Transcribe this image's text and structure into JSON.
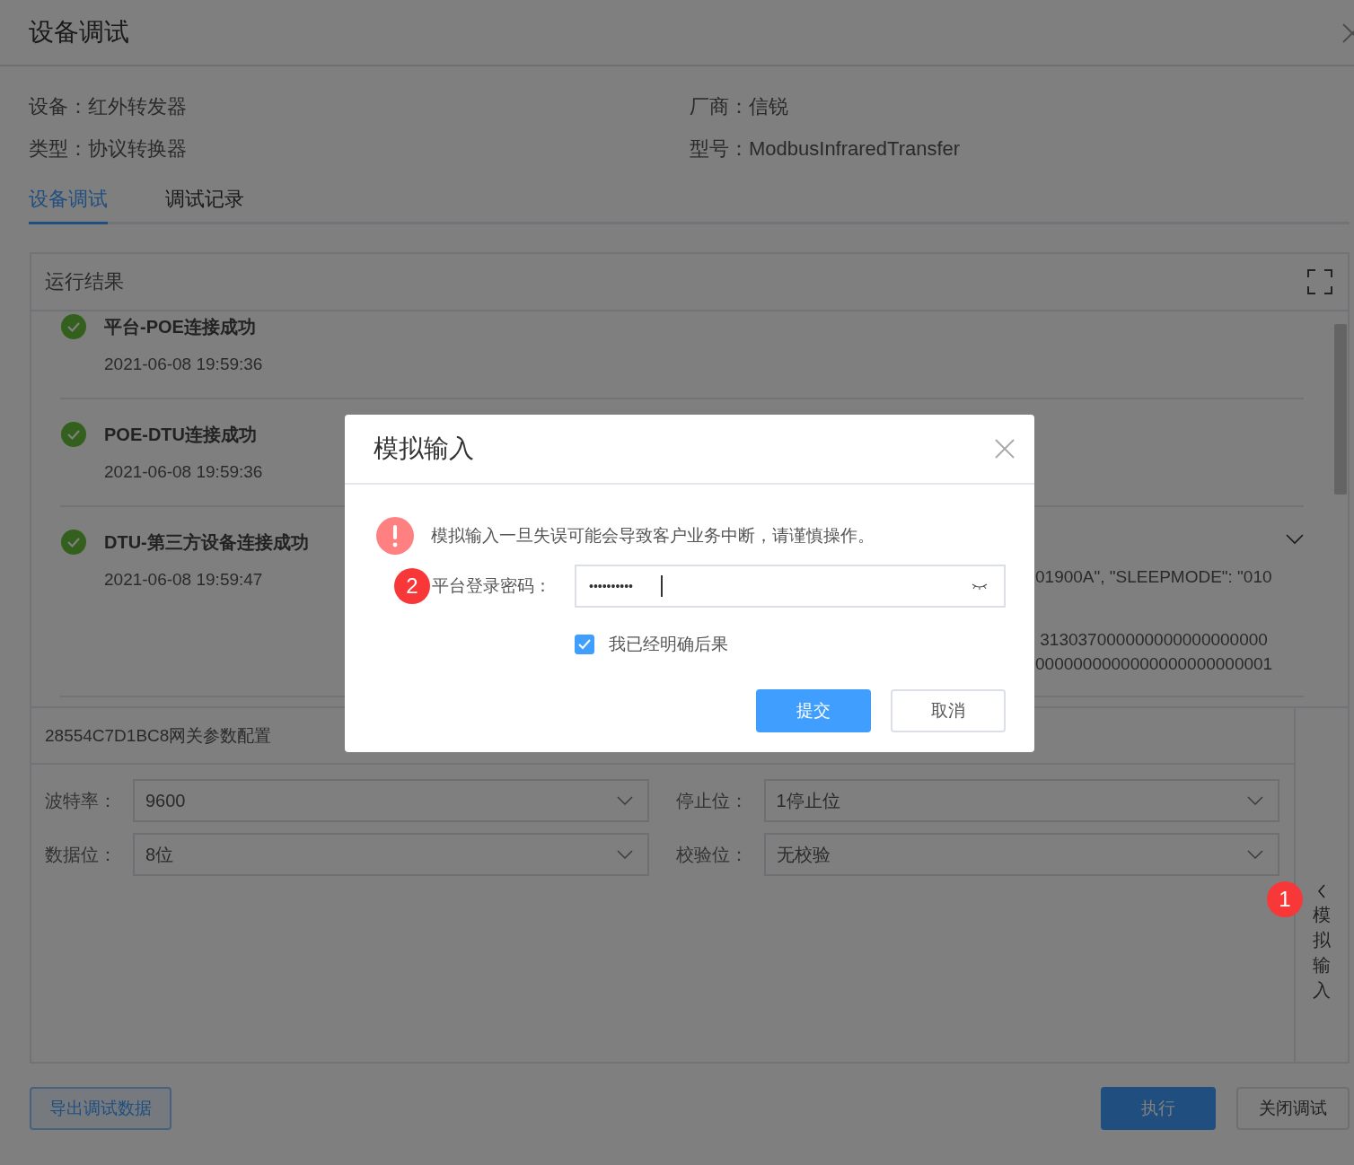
{
  "window": {
    "title": "设备调试"
  },
  "info": [
    {
      "text": "设备：红外转发器"
    },
    {
      "text": "厂商：信锐"
    },
    {
      "text": "类型：协议转换器"
    },
    {
      "text": "型号：ModbusInfraredTransfer"
    }
  ],
  "tabs": [
    {
      "label": "设备调试",
      "selected": true
    },
    {
      "label": "调试记录",
      "selected": false
    }
  ],
  "results": {
    "title": "运行结果",
    "items": [
      {
        "title": "平台-POE连接成功",
        "time": "2021-06-08 19:59:36",
        "success": true
      },
      {
        "title": "POE-DTU连接成功",
        "time": "2021-06-08 19:59:36",
        "success": true
      },
      {
        "title": "DTU-第三方设备连接成功",
        "time": "2021-06-08 19:59:47",
        "success": true,
        "expanded": false,
        "details": [
          {
            "lines": [
              {
                "text": "01900A\", \"SLEEPMODE\": \"010"
              }
            ]
          },
          {
            "lines": [
              {
                "text": " 313037000000000000000000"
              },
              {
                "text": "0000000000000000000000001"
              }
            ]
          }
        ]
      }
    ]
  },
  "config": {
    "title": "28554C7D1BC8网关参数配置",
    "fields": [
      {
        "label": "波特率：",
        "value": "9600"
      },
      {
        "label": "停止位：",
        "value": "1停止位"
      },
      {
        "label": "数据位：",
        "value": "8位"
      },
      {
        "label": "校验位：",
        "value": "无校验"
      }
    ]
  },
  "side_tab": {
    "label": "模拟输入"
  },
  "footer": {
    "export": "导出调试数据",
    "execute": "执行",
    "close": "关闭调试"
  },
  "dialog": {
    "title": "模拟输入",
    "warning": "模拟输入一旦失误可能会导致客户业务中断，请谨慎操作。",
    "password_label": "平台登录密码：",
    "password_value": "••••••••••",
    "confirm": {
      "label": "我已经明确后果",
      "checked": true
    },
    "submit": "提交",
    "cancel": "取消"
  },
  "markers": [
    {
      "text": "1"
    },
    {
      "text": "2"
    }
  ]
}
